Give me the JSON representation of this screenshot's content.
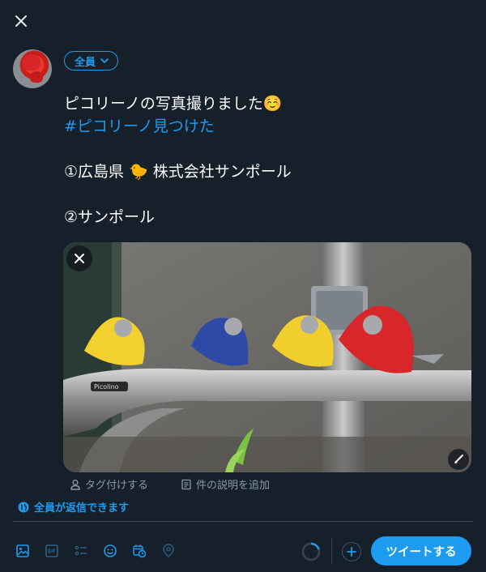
{
  "header": {
    "close_icon": "close-icon"
  },
  "composer": {
    "audience_label": "全員",
    "text_lines": [
      "ピコリーノの写真撮りました☺️",
      "#ピコリーノ見つけた",
      "",
      "①広島県 🐤 株式会社サンポール",
      "",
      "②サンポール"
    ],
    "hashtag_line_index": 1
  },
  "media": {
    "remove_icon": "close-icon",
    "edit_icon": "paintbrush-icon",
    "brand_label": "Picolino",
    "tag_label": "タグ付けする",
    "description_label": "件の説明を追加"
  },
  "reply_setting": {
    "label": "全員が返信できます",
    "icon": "globe-icon"
  },
  "toolbar": {
    "tools": [
      "image-icon",
      "gif-icon",
      "poll-icon",
      "emoji-icon",
      "schedule-icon",
      "location-icon"
    ],
    "tweet_label": "ツイートする"
  },
  "colors": {
    "accent": "#1d9bf0",
    "background": "#15202b",
    "muted": "#8b98a5",
    "border": "#38444d"
  }
}
